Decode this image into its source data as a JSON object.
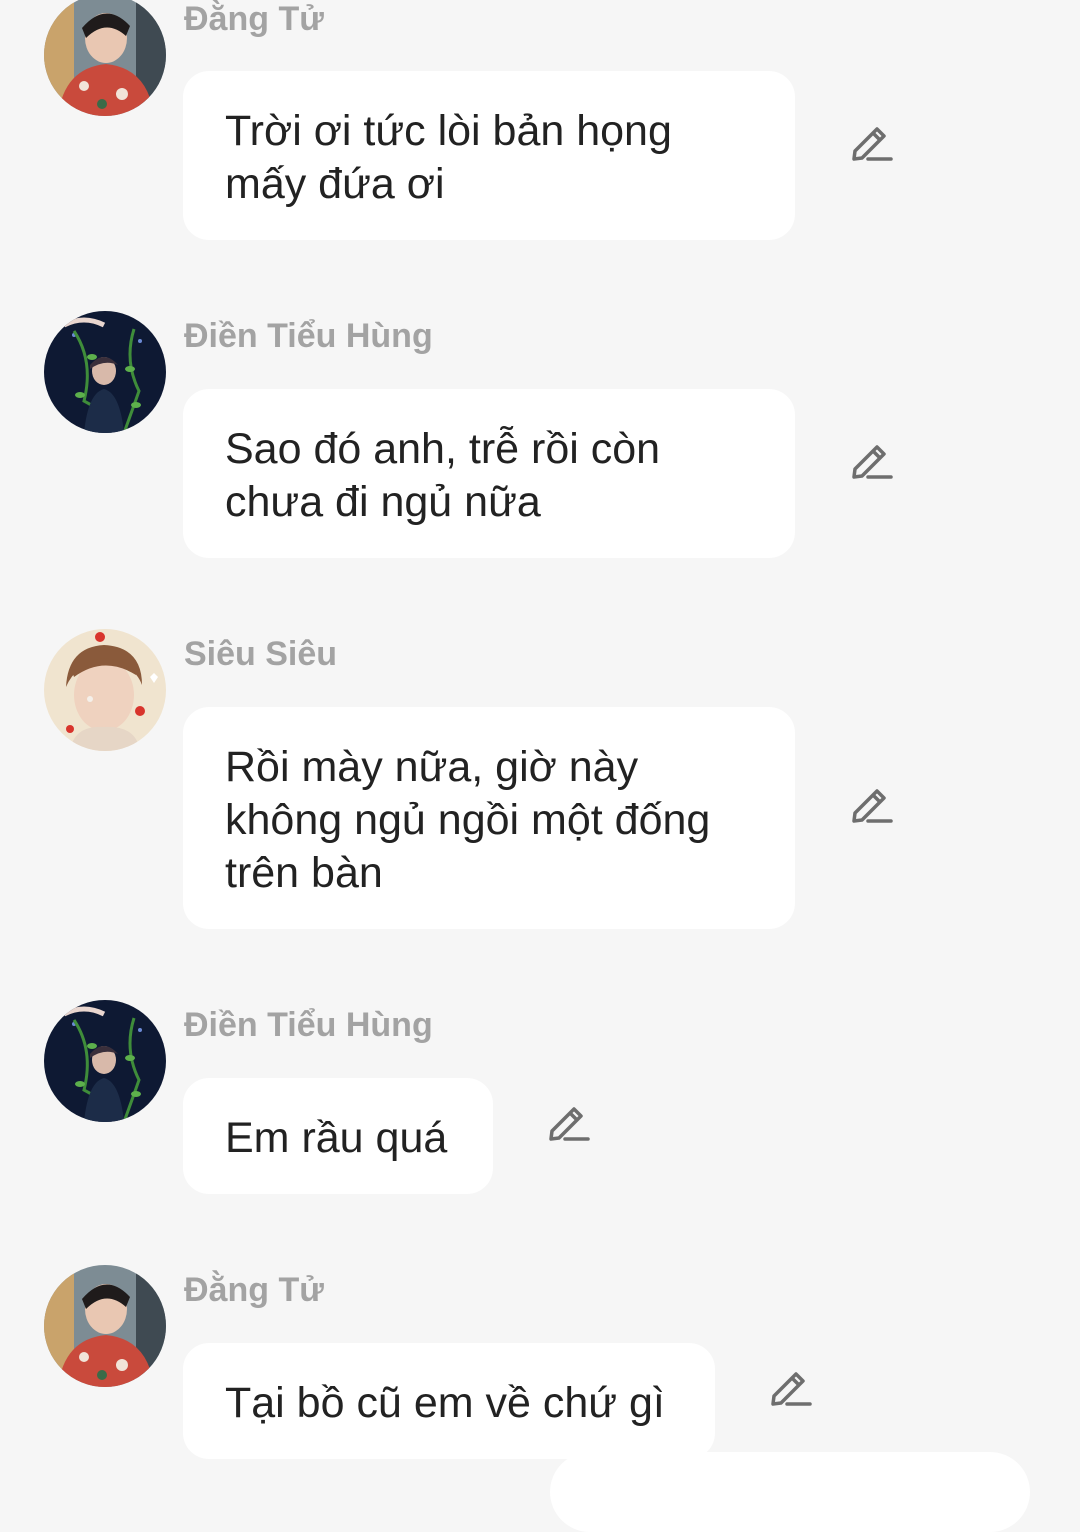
{
  "colors": {
    "background": "#f6f6f6",
    "bubble": "#ffffff",
    "text": "#222222",
    "sender_name": "#a3a3a3",
    "edit_icon": "#6e6e6e"
  },
  "messages": [
    {
      "sender": "Đằng Tử",
      "avatar": "dang-tu-avatar",
      "text": "Trời ơi tức lòi bản họng\nmấy đứa ơi",
      "action_icon": "edit-pencil-icon"
    },
    {
      "sender": "Điền Tiểu Hùng",
      "avatar": "dien-tieu-hung-avatar",
      "text": "Sao đó anh, trễ rồi còn\nchưa đi ngủ nữa",
      "action_icon": "edit-pencil-icon"
    },
    {
      "sender": "Siêu Siêu",
      "avatar": "sieu-sieu-avatar",
      "text": "Rồi mày nữa, giờ này\nkhông ngủ ngồi một đống\ntrên bàn",
      "action_icon": "edit-pencil-icon"
    },
    {
      "sender": "Điền Tiểu Hùng",
      "avatar": "dien-tieu-hung-avatar",
      "text": "Em rầu quá",
      "action_icon": "edit-pencil-icon"
    },
    {
      "sender": "Đằng Tử",
      "avatar": "dang-tu-avatar",
      "text": "Tại bồ cũ em về chứ gì",
      "action_icon": "edit-pencil-icon"
    }
  ]
}
